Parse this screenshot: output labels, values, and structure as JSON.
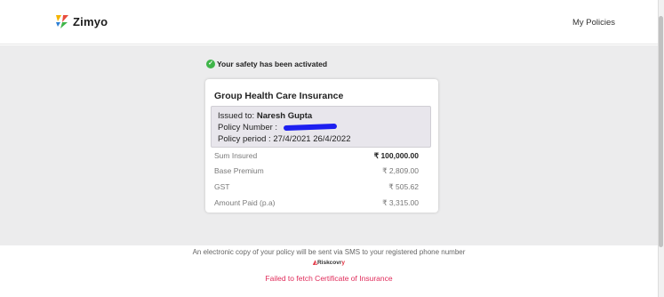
{
  "header": {
    "brand": "Zimyo",
    "nav_link": "My Policies"
  },
  "status": {
    "message": "Your safety has been activated"
  },
  "policy": {
    "title": "Group Health Care Insurance",
    "issued_label": "Issued to:",
    "issued_to": "Naresh Gupta",
    "number_label": "Policy Number :",
    "period_label": "Policy period :",
    "period": "27/4/2021 26/4/2022",
    "rows": [
      {
        "label": "Sum Insured",
        "amount": "₹ 100,000.00"
      },
      {
        "label": "Base Premium",
        "amount": "₹ 2,809.00"
      },
      {
        "label": "GST",
        "amount": "₹ 505.62"
      },
      {
        "label": "Amount Paid (p.a)",
        "amount": "₹ 3,315.00"
      }
    ]
  },
  "footer": {
    "note": "An electronic copy of your policy will be sent via SMS to your registered phone number",
    "partner_prefix": "Riskcovr",
    "partner_suffix": "y",
    "error": "Failed to fetch Certificate of Insurance"
  },
  "colors": {
    "check": "#3fb549",
    "error": "#e02b5a",
    "background": "#ececed"
  }
}
